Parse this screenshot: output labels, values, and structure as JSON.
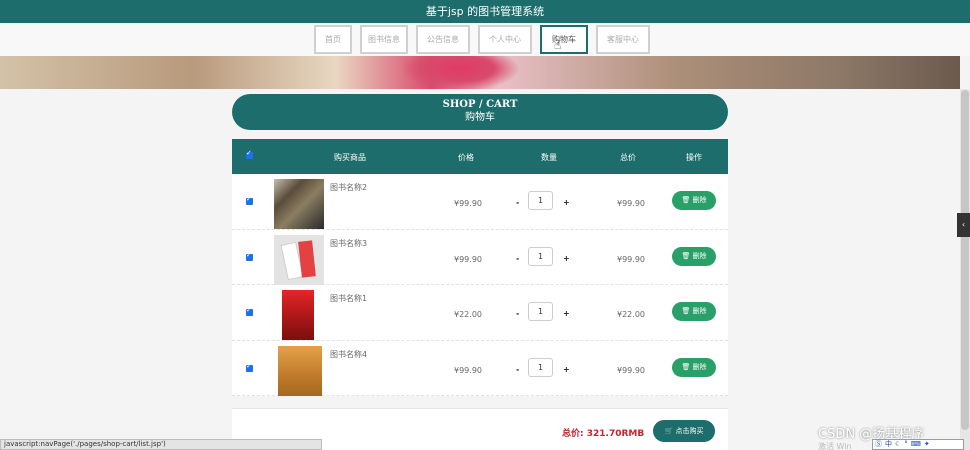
{
  "header": {
    "title": "基于jsp 的图书管理系统"
  },
  "nav": {
    "items": [
      {
        "label": "首页"
      },
      {
        "label": "图书信息"
      },
      {
        "label": "公告信息"
      },
      {
        "label": "个人中心"
      },
      {
        "label": "购物车"
      },
      {
        "label": "客服中心"
      }
    ],
    "active_index": 4
  },
  "page_heading": {
    "en": "SHOP / CART",
    "zh": "购物车"
  },
  "table": {
    "columns": [
      "购买商品",
      "价格",
      "数量",
      "总价",
      "操作"
    ],
    "rows": [
      {
        "name": "图书名称2",
        "price": "¥99.90",
        "qty": "1",
        "total": "¥99.90",
        "action": "删除",
        "checked": true
      },
      {
        "name": "图书名称3",
        "price": "¥99.90",
        "qty": "1",
        "total": "¥99.90",
        "action": "删除",
        "checked": true
      },
      {
        "name": "图书名称1",
        "price": "¥22.00",
        "qty": "1",
        "total": "¥22.00",
        "action": "删除",
        "checked": true
      },
      {
        "name": "图书名称4",
        "price": "¥99.90",
        "qty": "1",
        "total": "¥99.90",
        "action": "删除",
        "checked": true
      }
    ],
    "minus": "-",
    "plus": "+"
  },
  "footer": {
    "total_label": "总价: 321.70RMB",
    "buy_label": "点击购买"
  },
  "status_bar": {
    "text": "javascript:navPage('./pages/shop-cart/list.jsp')"
  },
  "watermark": {
    "text": "CSDN @扬基程序",
    "activate": "激活 Win"
  },
  "ime": {
    "label": "中"
  },
  "colors": {
    "primary": "#1c6d6b",
    "delete": "#2aa069",
    "total": "#c8232c",
    "checkbox": "#1a73e8"
  },
  "icons": {
    "trash": "trash-icon",
    "cart": "cart-icon",
    "cursor": "hand-cursor-icon"
  }
}
